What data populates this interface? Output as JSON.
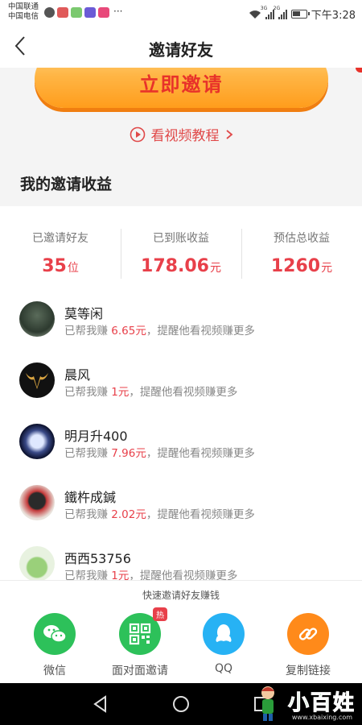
{
  "status_bar": {
    "carrier1": "中国联通",
    "carrier2": "中国电信",
    "net1": "3G",
    "net2": "2G",
    "more": "···",
    "time": "下午3:28"
  },
  "nav": {
    "title": "邀请好友",
    "back_icon": "chevron-left-icon"
  },
  "invite": {
    "button_label": "立即邀请",
    "tutorial_label": "看视频教程",
    "tutorial_arrow": "›"
  },
  "earnings": {
    "section_title": "我的邀请收益",
    "stats": [
      {
        "label": "已邀请好友",
        "value": "35",
        "unit": "位"
      },
      {
        "label": "已到账收益",
        "value": "178.06",
        "unit": "元"
      },
      {
        "label": "预估总收益",
        "value": "1260",
        "unit": "元"
      }
    ]
  },
  "friends": [
    {
      "name": "莫等闲",
      "prefix": "已帮我赚",
      "amount": "6.65元",
      "suffix": "，提醒他看视频赚更多"
    },
    {
      "name": "晨风",
      "prefix": "已帮我赚",
      "amount": "1元",
      "suffix": "，提醒他看视频赚更多"
    },
    {
      "name": "明月升400",
      "prefix": "已帮我赚",
      "amount": "7.96元",
      "suffix": "，提醒他看视频赚更多"
    },
    {
      "name": "鐵杵成鍼",
      "prefix": "已帮我赚",
      "amount": "2.02元",
      "suffix": "，提醒他看视频赚更多"
    },
    {
      "name": "西西53756",
      "prefix": "已帮我赚",
      "amount": "1元",
      "suffix": "，提醒他看视频赚更多"
    }
  ],
  "share": {
    "title": "快速邀请好友赚钱",
    "options": [
      {
        "label": "微信",
        "icon": "wechat-icon",
        "color": "#2dc15a"
      },
      {
        "label": "面对面邀请",
        "icon": "qrcode-icon",
        "color": "#2dc15a",
        "badge": "热"
      },
      {
        "label": "QQ",
        "icon": "qq-icon",
        "color": "#27b2f4"
      },
      {
        "label": "复制链接",
        "icon": "link-icon",
        "color": "#ff8a1a"
      }
    ]
  },
  "watermark": {
    "text": "小百姓",
    "url": "www.xbaixing.com"
  },
  "colors": {
    "accent_red": "#e8404a",
    "button_orange": "#ffb544"
  }
}
